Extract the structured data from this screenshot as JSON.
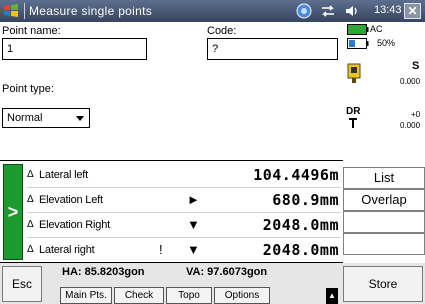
{
  "titlebar": {
    "title": "Measure single points",
    "time": "13:43",
    "close_label": "✕"
  },
  "form": {
    "point_name_label": "Point name:",
    "point_name_value": "1",
    "code_label": "Code:",
    "code_value": "?",
    "point_type_label": "Point type:",
    "point_type_value": "Normal"
  },
  "status": {
    "ac_label": "AC",
    "battery_percent": "50%",
    "s_label": "S",
    "s_value": "0.000",
    "dr_label": "DR",
    "dr_top_value": "+0",
    "dr_bottom_value": "0.000"
  },
  "readings": {
    "go_label": ">",
    "rows": [
      {
        "delta": "Δ",
        "label": "Lateral left",
        "marker": "",
        "value": "104.4496m"
      },
      {
        "delta": "Δ",
        "label": "Elevation Left",
        "marker": "►",
        "value": "680.9mm"
      },
      {
        "delta": "Δ",
        "label": "Elevation Right",
        "marker": "▼",
        "value": "2048.0mm"
      },
      {
        "delta": "Δ",
        "label": "Lateral right",
        "marker": "▼",
        "value": "2048.0mm",
        "extra": "!"
      }
    ]
  },
  "side_buttons": {
    "list": "List",
    "overlap": "Overlap"
  },
  "bottom": {
    "esc": "Esc",
    "ha": "HA: 85.8203gon",
    "va": "VA: 97.6073gon",
    "tabs": [
      "Main Pts.",
      "Check",
      "Topo",
      "Options"
    ],
    "store": "Store"
  },
  "colors": {
    "titlebar": "#37455f",
    "go_tab": "#1c9a2e",
    "battery_green": "#2fa832"
  }
}
